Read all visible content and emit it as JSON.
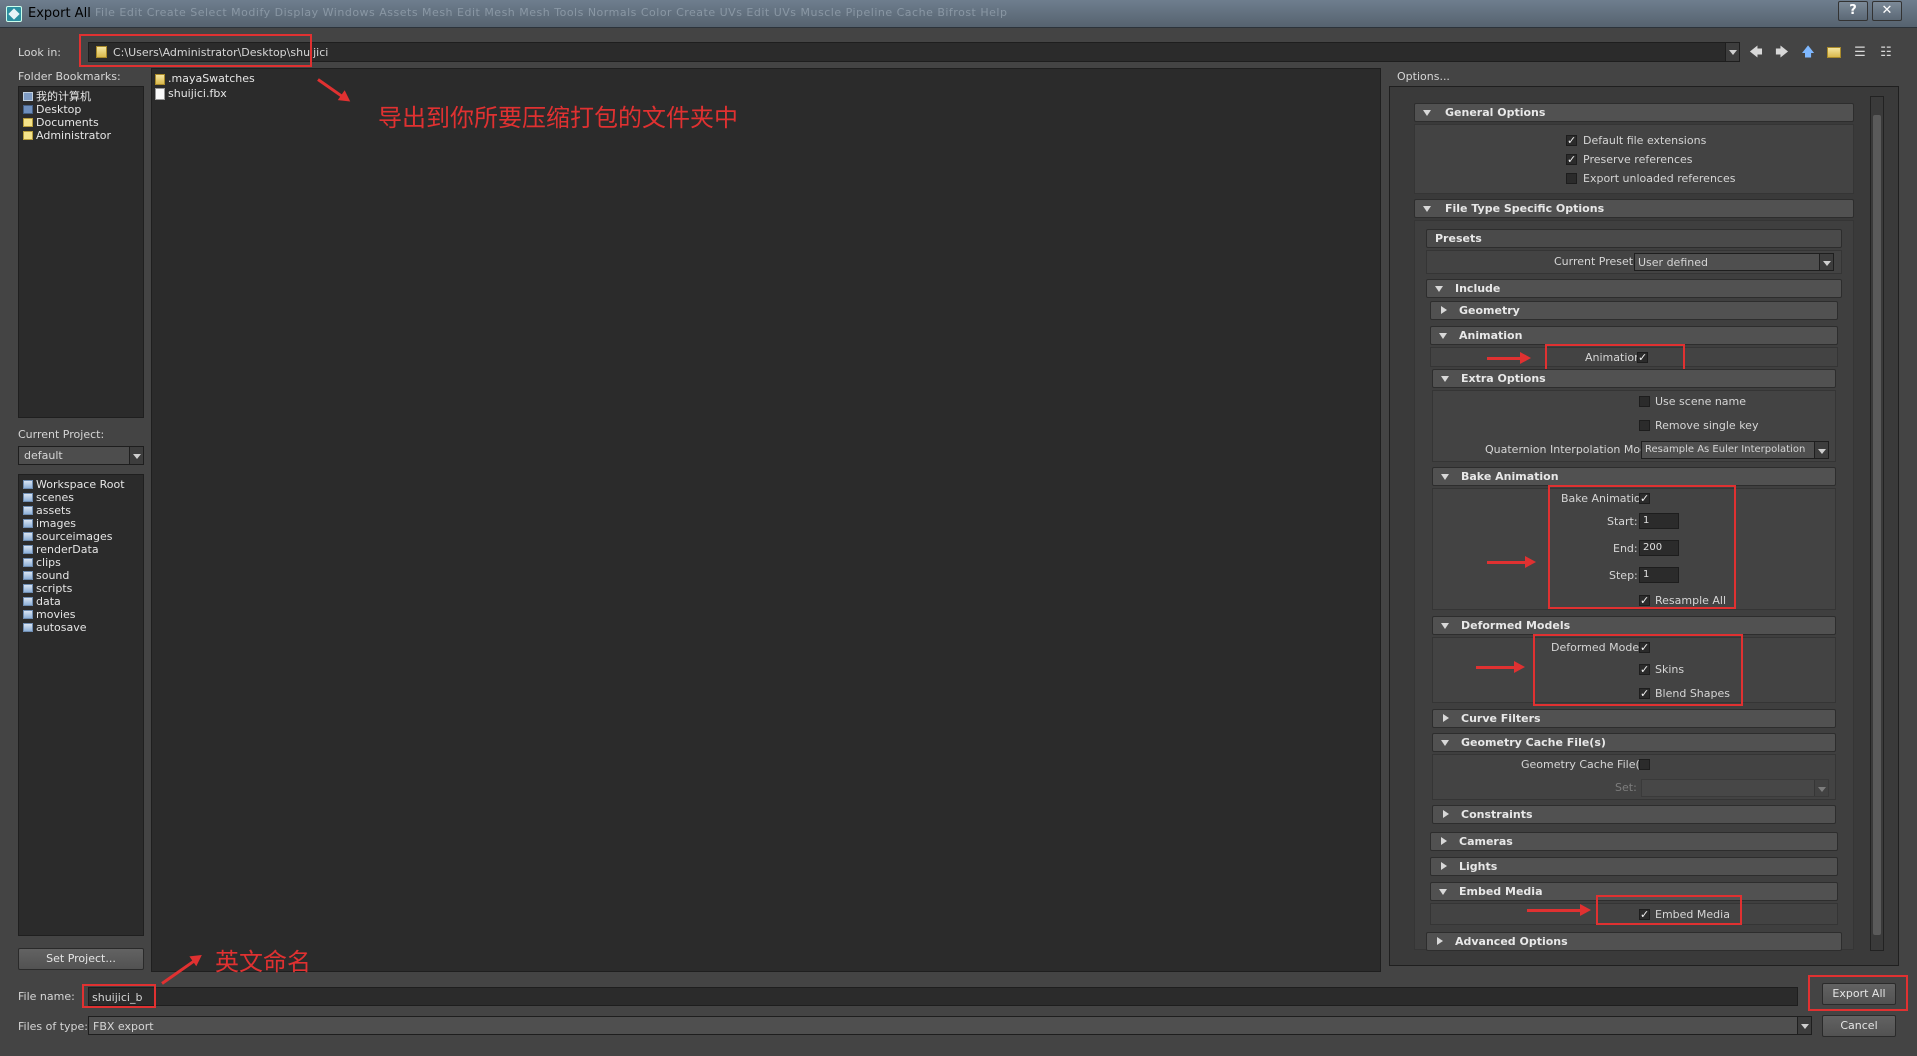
{
  "window": {
    "title": "Export All",
    "help_glyph": "?",
    "close_glyph": "✕",
    "menu_ghost": "File   Edit   Create   Select   Modify   Display   Windows   Assets   Mesh   Edit Mesh   Mesh Tools   Normals   Color   Create UVs   Edit UVs   Muscle   Pipeline Cache   Bifrost   Help"
  },
  "look_in": {
    "label": "Look in:",
    "path": "C:\\Users\\Administrator\\Desktop\\shuijici"
  },
  "toolbar_icons": [
    "back-icon",
    "forward-icon",
    "up-folder-icon",
    "new-folder-icon",
    "list-view-icon",
    "detail-view-icon"
  ],
  "bookmarks": {
    "label": "Folder Bookmarks:",
    "items": [
      "我的计算机",
      "Desktop",
      "Documents",
      "Administrator"
    ]
  },
  "current_project": {
    "label": "Current Project:",
    "value": "default",
    "folders": [
      "Workspace Root",
      "scenes",
      "assets",
      "images",
      "sourceimages",
      "renderData",
      "clips",
      "sound",
      "scripts",
      "data",
      "movies",
      "autosave"
    ],
    "set_project_label": "Set Project..."
  },
  "files": [
    ".mayaSwatches",
    "shuijici.fbx"
  ],
  "options": {
    "title": "Options...",
    "general": {
      "header": "General Options",
      "default_ext": "Default file extensions",
      "preserve_refs": "Preserve references",
      "export_unloaded": "Export unloaded references"
    },
    "file_type": {
      "header": "File Type Specific Options",
      "presets_header": "Presets",
      "current_preset_label": "Current Preset:",
      "current_preset_value": "User defined",
      "include_header": "Include",
      "geometry_header": "Geometry",
      "animation_header": "Animation",
      "animation_label": "Animation",
      "extra_options_header": "Extra Options",
      "use_scene_name": "Use scene name",
      "remove_single_key": "Remove single key",
      "quaternion_label": "Quaternion Interpolation Mode:",
      "quaternion_value": "Resample As Euler Interpolation",
      "bake_header": "Bake Animation",
      "bake_label": "Bake Animation",
      "start_label": "Start:",
      "start_value": "1",
      "end_label": "End:",
      "end_value": "200",
      "step_label": "Step:",
      "step_value": "1",
      "resample_all": "Resample All",
      "deformed_header": "Deformed Models",
      "deformed_label": "Deformed Models",
      "skins": "Skins",
      "blend_shapes": "Blend Shapes",
      "curve_filters_header": "Curve Filters",
      "geo_cache_header": "Geometry Cache File(s)",
      "geo_cache_label": "Geometry Cache File(s)",
      "set_label": "Set:",
      "constraints_header": "Constraints",
      "cameras_header": "Cameras",
      "lights_header": "Lights",
      "embed_header": "Embed Media",
      "embed_label": "Embed Media",
      "advanced_header": "Advanced Options"
    }
  },
  "bottom": {
    "file_name_label": "File name:",
    "file_name_value": "shuijici_b",
    "files_of_type_label": "Files of type:",
    "files_of_type_value": "FBX export",
    "export_label": "Export All",
    "cancel_label": "Cancel"
  },
  "annotations": {
    "folder_note": "导出到你所要压缩打包的文件夹中",
    "name_note": "英文命名"
  },
  "check_glyph": "✓",
  "colors": {
    "annotation_red": "#e03131",
    "panel_dark": "#2b2b2b",
    "dialog_bg": "#444444"
  }
}
